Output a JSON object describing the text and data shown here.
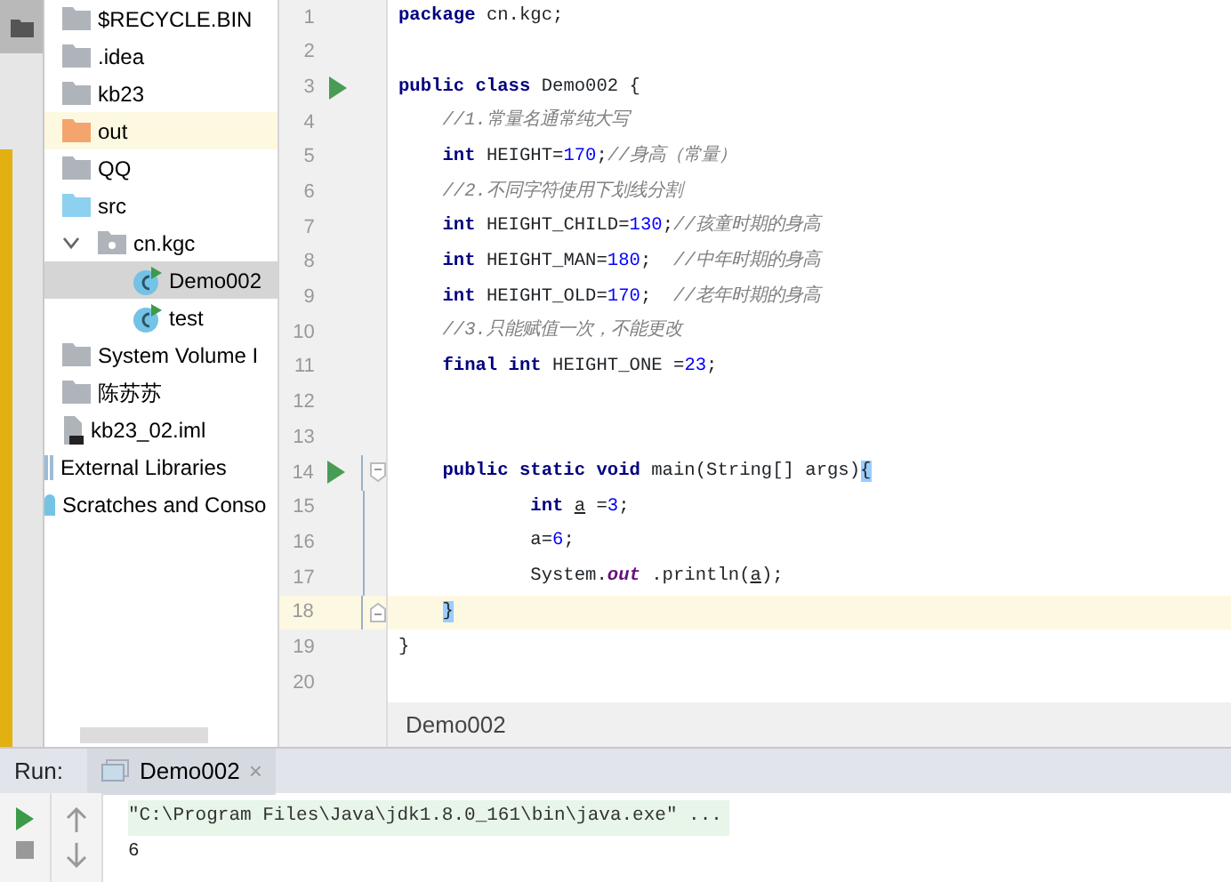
{
  "project_tree": [
    {
      "label": "$RECYCLE.BIN",
      "kind": "folder",
      "selected": false,
      "highlighted": false
    },
    {
      "label": ".idea",
      "kind": "folder",
      "selected": false,
      "highlighted": false
    },
    {
      "label": "kb23",
      "kind": "folder",
      "selected": false,
      "highlighted": false
    },
    {
      "label": "out",
      "kind": "excluded-folder",
      "selected": false,
      "highlighted": true
    },
    {
      "label": "QQ",
      "kind": "folder",
      "selected": false,
      "highlighted": false
    },
    {
      "label": "src",
      "kind": "source-folder",
      "selected": false,
      "highlighted": false,
      "children": [
        {
          "label": "cn.kgc",
          "kind": "package",
          "selected": false,
          "highlighted": false,
          "expanded": true,
          "children": [
            {
              "label": "Demo002",
              "kind": "class",
              "selected": true,
              "highlighted": false
            },
            {
              "label": "test",
              "kind": "class",
              "selected": false,
              "highlighted": false
            }
          ]
        }
      ]
    },
    {
      "label": "System Volume I",
      "kind": "folder",
      "selected": false,
      "highlighted": false
    },
    {
      "label": "陈苏苏",
      "kind": "folder",
      "selected": false,
      "highlighted": false
    },
    {
      "label": "kb23_02.iml",
      "kind": "module-file",
      "selected": false,
      "highlighted": false
    },
    {
      "label": "External Libraries",
      "kind": "library",
      "selected": false,
      "highlighted": false
    },
    {
      "label": "Scratches and Conso",
      "kind": "scratches",
      "selected": false,
      "highlighted": false
    }
  ],
  "editor": {
    "lines": [
      {
        "number": "1",
        "run": false,
        "current": false,
        "tokens": [
          {
            "kind": "kw",
            "text": "package"
          },
          {
            "kind": "plain",
            "text": " cn.kgc;"
          }
        ]
      },
      {
        "number": "2",
        "run": false,
        "current": false
      },
      {
        "number": "3",
        "run": true,
        "current": false,
        "tokens": [
          {
            "kind": "kw",
            "text": "public class"
          },
          {
            "kind": "plain",
            "text": " Demo002 {"
          }
        ]
      },
      {
        "number": "4",
        "run": false,
        "current": false,
        "tokens": [
          {
            "kind": "comment",
            "text": "    //1.常量名通常纯大写"
          }
        ]
      },
      {
        "number": "5",
        "run": false,
        "current": false,
        "tokens": [
          {
            "kind": "kw",
            "text": "    int"
          },
          {
            "kind": "plain",
            "text": " HEIGHT="
          },
          {
            "kind": "num",
            "text": "170"
          },
          {
            "kind": "plain",
            "text": ";"
          },
          {
            "kind": "comment",
            "text": "//身高（常量）"
          }
        ]
      },
      {
        "number": "6",
        "run": false,
        "current": false,
        "tokens": [
          {
            "kind": "comment",
            "text": "    //2.不同字符使用下划线分割"
          }
        ]
      },
      {
        "number": "7",
        "run": false,
        "current": false,
        "tokens": [
          {
            "kind": "kw",
            "text": "    int"
          },
          {
            "kind": "plain",
            "text": " HEIGHT_CHILD="
          },
          {
            "kind": "num",
            "text": "130"
          },
          {
            "kind": "plain",
            "text": ";"
          },
          {
            "kind": "comment",
            "text": "//孩童时期的身高"
          }
        ]
      },
      {
        "number": "8",
        "run": false,
        "current": false,
        "tokens": [
          {
            "kind": "kw",
            "text": "    int"
          },
          {
            "kind": "plain",
            "text": " HEIGHT_MAN="
          },
          {
            "kind": "num",
            "text": "180"
          },
          {
            "kind": "plain",
            "text": ";  "
          },
          {
            "kind": "comment",
            "text": "//中年时期的身高"
          }
        ]
      },
      {
        "number": "9",
        "run": false,
        "current": false,
        "tokens": [
          {
            "kind": "kw",
            "text": "    int"
          },
          {
            "kind": "plain",
            "text": " HEIGHT_OLD="
          },
          {
            "kind": "num",
            "text": "170"
          },
          {
            "kind": "plain",
            "text": ";  "
          },
          {
            "kind": "comment",
            "text": "//老年时期的身高"
          }
        ]
      },
      {
        "number": "10",
        "run": false,
        "current": false,
        "tokens": [
          {
            "kind": "comment",
            "text": "    //3.只能赋值一次，不能更改"
          }
        ]
      },
      {
        "number": "11",
        "run": false,
        "current": false,
        "tokens": [
          {
            "kind": "kw",
            "text": "    final int"
          },
          {
            "kind": "plain",
            "text": " HEIGHT_ONE ="
          },
          {
            "kind": "num",
            "text": "23"
          },
          {
            "kind": "plain",
            "text": ";"
          }
        ]
      },
      {
        "number": "12",
        "run": false,
        "current": false
      },
      {
        "number": "13",
        "run": false,
        "current": false
      },
      {
        "number": "14",
        "run": true,
        "fold_start": true,
        "current": false,
        "tokens": [
          {
            "kind": "kw",
            "text": "    public static void"
          },
          {
            "kind": "plain",
            "text": " main(String[] args)"
          },
          {
            "kind": "brace",
            "text": "{"
          }
        ]
      },
      {
        "number": "15",
        "run": false,
        "current": false,
        "tokens": [
          {
            "kind": "kw",
            "text": "            int "
          },
          {
            "kind": "var",
            "text": "a"
          },
          {
            "kind": "plain",
            "text": " ="
          },
          {
            "kind": "num",
            "text": "3"
          },
          {
            "kind": "plain",
            "text": ";"
          }
        ]
      },
      {
        "number": "16",
        "run": false,
        "current": false,
        "tokens": [
          {
            "kind": "plain",
            "text": "            a="
          },
          {
            "kind": "num",
            "text": "6"
          },
          {
            "kind": "plain",
            "text": ";"
          }
        ]
      },
      {
        "number": "17",
        "run": false,
        "current": false,
        "tokens": [
          {
            "kind": "plain",
            "text": "            System."
          },
          {
            "kind": "static",
            "text": "out"
          },
          {
            "kind": "plain",
            "text": " .println("
          },
          {
            "kind": "var",
            "text": "a"
          },
          {
            "kind": "plain",
            "text": ");"
          }
        ]
      },
      {
        "number": "18",
        "run": false,
        "fold_end": true,
        "current": true,
        "tokens": [
          {
            "kind": "brace",
            "text": "    }"
          }
        ]
      },
      {
        "number": "19",
        "run": false,
        "current": false,
        "tokens": [
          {
            "kind": "plain",
            "text": "}"
          }
        ]
      },
      {
        "number": "20",
        "run": false,
        "current": false
      }
    ],
    "breadcrumb": "Demo002"
  },
  "run_panel": {
    "label": "Run:",
    "tabs": [
      {
        "label": "Demo002",
        "close": "×",
        "selected": true
      }
    ],
    "console": [
      {
        "kind": "command",
        "text": "\"C:\\Program Files\\Java\\jdk1.8.0_161\\bin\\java.exe\" ..."
      },
      {
        "kind": "output",
        "text": "6"
      }
    ]
  }
}
